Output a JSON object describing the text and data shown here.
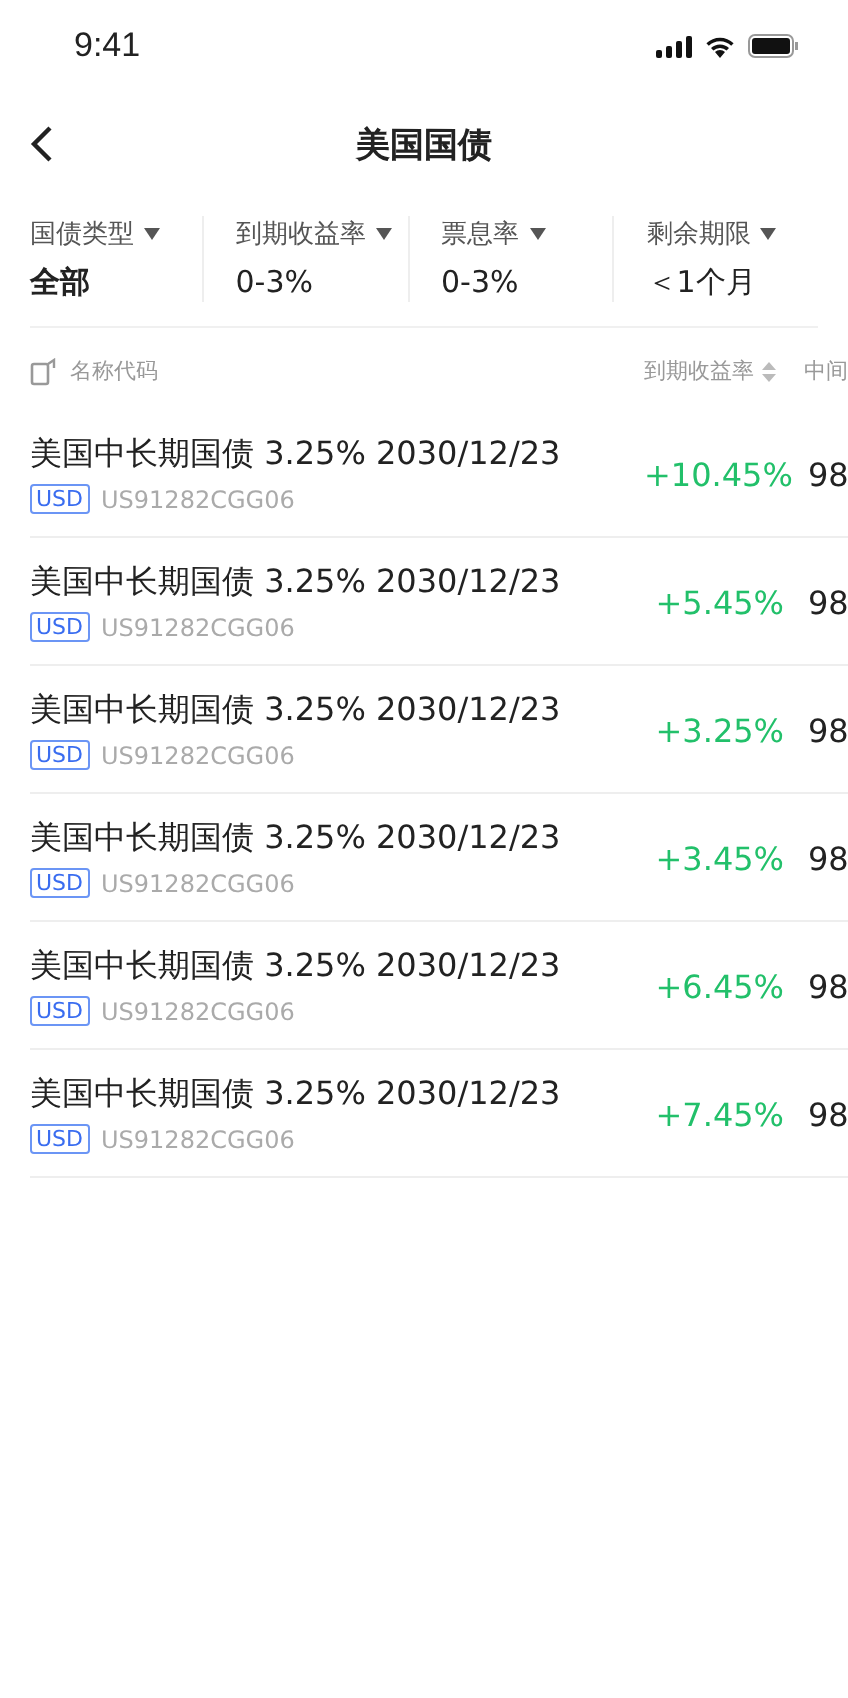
{
  "status_bar": {
    "time": "9:41"
  },
  "nav": {
    "title": "美国国债"
  },
  "filters": [
    {
      "label": "国债类型",
      "value": "全部"
    },
    {
      "label": "到期收益率",
      "value": "0-3%"
    },
    {
      "label": "票息率",
      "value": "0-3%"
    },
    {
      "label": "剩余期限",
      "value": "＜1个月"
    }
  ],
  "table": {
    "columns": [
      {
        "label": "名称代码"
      },
      {
        "label": "到期收益率"
      },
      {
        "label": "中间"
      }
    ],
    "rows": [
      {
        "name": "美国中长期国债 3.25% 2030/12/23",
        "currency": "USD",
        "code": "US91282CGG06",
        "yield": "+10.45%",
        "column_3": "98"
      },
      {
        "name": "美国中长期国债 3.25% 2030/12/23",
        "currency": "USD",
        "code": "US91282CGG06",
        "yield": "+5.45%",
        "column_3": "98"
      },
      {
        "name": "美国中长期国债 3.25% 2030/12/23",
        "currency": "USD",
        "code": "US91282CGG06",
        "yield": "+3.25%",
        "column_3": "98"
      },
      {
        "name": "美国中长期国债 3.25% 2030/12/23",
        "currency": "USD",
        "code": "US91282CGG06",
        "yield": "+3.45%",
        "column_3": "98"
      },
      {
        "name": "美国中长期国债 3.25% 2030/12/23",
        "currency": "USD",
        "code": "US91282CGG06",
        "yield": "+6.45%",
        "column_3": "98"
      },
      {
        "name": "美国中长期国债 3.25% 2030/12/23",
        "currency": "USD",
        "code": "US91282CGG06",
        "yield": "+7.45%",
        "column_3": "98"
      }
    ]
  }
}
